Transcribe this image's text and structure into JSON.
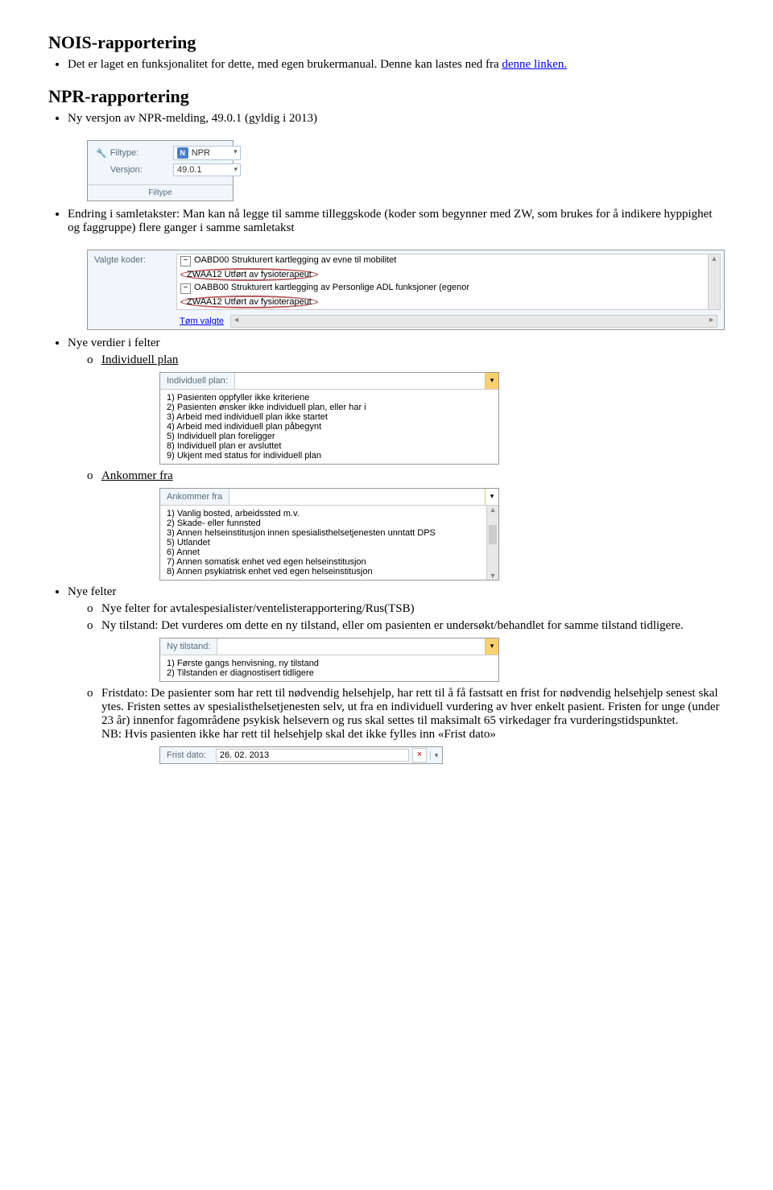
{
  "nois": {
    "heading": "NOIS-rapportering",
    "text_before": "Det er laget en funksjonalitet for dette, med egen brukermanual. Denne kan lastes ned fra ",
    "link_text": "denne linken.",
    "link_href": "#"
  },
  "npr": {
    "heading": "NPR-rapportering",
    "item1": "Ny versjon av NPR-melding, 49.0.1 (gyldig i 2013)",
    "filtype_screenshot": {
      "filtype_label": "Filtype:",
      "filtype_icon_letter": "N",
      "filtype_value": "NPR",
      "versjon_label": "Versjon:",
      "versjon_value": "49.0.1",
      "ribbon": "Filtype"
    },
    "item2": "Endring i samletakster: Man kan nå legge til samme tilleggskode (koder som begynner med ZW, som brukes for å indikere hyppighet og faggruppe) flere ganger i samme samletakst",
    "koder_screenshot": {
      "label": "Valgte koder:",
      "row1": "OABD00 Strukturert kartlegging av evne til mobilitet",
      "row2": "ZWAA12 Utført av fysioterapeut",
      "row3": "OABB00 Strukturert kartlegging av Personlige ADL funksjoner (egenor",
      "row4": "ZWAA12 Utført av fysioterapeut",
      "tom_link": "Tøm valgte"
    },
    "item3": "Nye verdier i felter",
    "sub3a": "Individuell plan",
    "indiv_plan": {
      "header_label": "Individuell plan:",
      "options": [
        "1) Pasienten oppfyller ikke kriteriene",
        "2) Pasienten ønsker ikke individuell plan, eller har i",
        "3) Arbeid med individuell plan ikke startet",
        "4) Arbeid med individuell plan påbegynt",
        "5) Individuell plan foreligger",
        "8) Individuell plan er avsluttet",
        "9) Ukjent med status for individuell plan"
      ]
    },
    "sub3b": "Ankommer fra",
    "ankommer": {
      "header_label": "Ankommer fra",
      "options": [
        "1) Vanlig bosted, arbeidssted m.v.",
        "2) Skade- eller funnsted",
        "3) Annen helseinstitusjon innen spesialisthelsetjenesten unntatt DPS",
        "5) Utlandet",
        "6) Annet",
        "7) Annen somatisk enhet ved egen helseinstitusjon",
        "8) Annen psykiatrisk enhet ved egen helseinstitusjon"
      ]
    },
    "item4": "Nye felter",
    "sub4a": "Nye felter for avtalespesialister/ventelisterapportering/Rus(TSB)",
    "sub4b": "Ny tilstand: Det vurderes om dette en ny tilstand, eller om pasienten er undersøkt/behandlet for samme tilstand tidligere.",
    "tilstand": {
      "header_label": "Ny tilstand:",
      "options": [
        "1) Første gangs henvisning, ny tilstand",
        "2) Tilstanden er diagnostisert tidligere"
      ]
    },
    "sub4c_para1": "Fristdato: De pasienter som har rett til nødvendig helsehjelp, har rett til å få fastsatt en frist for nødvendig helsehjelp senest skal ytes. Fristen settes av spesialisthelsetjenesten selv, ut fra en individuell vurdering av hver enkelt pasient. Fristen for unge (under 23 år) innenfor fagområdene psykisk helsevern og rus skal settes til maksimalt 65 virkedager fra vurderingstidspunktet.",
    "sub4c_para2": "NB: Hvis pasienten ikke har rett til helsehjelp skal det ikke fylles inn «Frist dato»",
    "fristdato": {
      "label": "Frist dato:",
      "value": "26. 02. 2013",
      "clear": "×"
    }
  }
}
